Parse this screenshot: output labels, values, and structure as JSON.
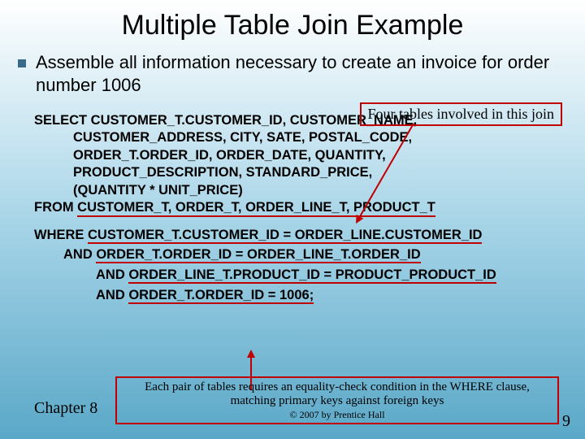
{
  "title": "Multiple Table Join Example",
  "bullet": "Assemble all information necessary to create an invoice for order number 1006",
  "callout_top": "Four tables involved in this join",
  "sql": {
    "l1": "SELECT CUSTOMER_T.CUSTOMER_ID, CUSTOMER_NAME,",
    "l2": "CUSTOMER_ADDRESS, CITY, SATE, POSTAL_CODE,",
    "l3": "ORDER_T.ORDER_ID, ORDER_DATE, QUANTITY,",
    "l4": "PRODUCT_DESCRIPTION, STANDARD_PRICE,",
    "l5": "(QUANTITY * UNIT_PRICE)",
    "l6a": "FROM ",
    "l6b": "CUSTOMER_T, ORDER_T, ORDER_LINE_T, PRODUCT_T"
  },
  "where": {
    "w1a": "WHERE  ",
    "w1b": "CUSTOMER_T.CUSTOMER_ID = ORDER_LINE.CUSTOMER_ID",
    "w2a": "AND ",
    "w2b": "ORDER_T.ORDER_ID = ORDER_LINE_T.ORDER_ID",
    "w3a": "AND ",
    "w3b": "ORDER_LINE_T.PRODUCT_ID = PRODUCT_PRODUCT_ID",
    "w4a": "AND ",
    "w4b": "ORDER_T.ORDER_ID = 1006;"
  },
  "callout_bottom_line1": "Each pair of tables requires an equality-check condition in the WHERE clause,",
  "callout_bottom_line2": "matching primary keys against foreign keys",
  "copyright": "© 2007 by Prentice Hall",
  "chapter": "Chapter 8",
  "pagenum": "9"
}
